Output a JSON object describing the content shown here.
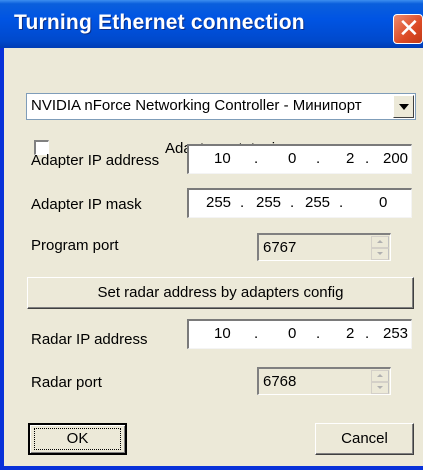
{
  "window": {
    "title": "Turning Ethernet connection"
  },
  "adapter": {
    "selected": "NVIDIA nForce Networking Controller - Минипорт"
  },
  "autotuning": {
    "label": "Adapter autotuning",
    "checked": false
  },
  "adapter_ip": {
    "label": "Adapter IP address",
    "octets": [
      "10",
      "0",
      "2",
      "200"
    ]
  },
  "adapter_mask": {
    "label": "Adapter IP mask",
    "octets": [
      "255",
      "255",
      "255",
      "0"
    ]
  },
  "program_port": {
    "label": "Program port",
    "value": "6767"
  },
  "set_radar_button": {
    "label": "Set radar address by adapters config"
  },
  "radar_ip": {
    "label": "Radar IP address",
    "octets": [
      "10",
      "0",
      "2",
      "253"
    ]
  },
  "radar_port": {
    "label": "Radar port",
    "value": "6768"
  },
  "buttons": {
    "ok": "OK",
    "cancel": "Cancel"
  },
  "ip_separator": "."
}
